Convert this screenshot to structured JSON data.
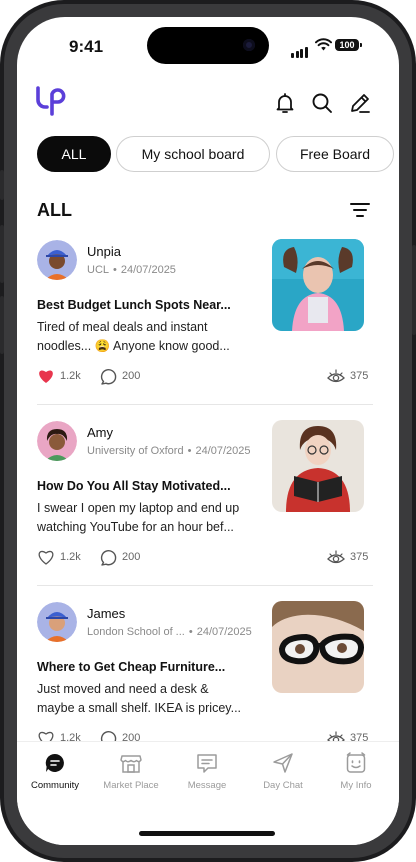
{
  "status_bar": {
    "time": "9:41",
    "battery": "100"
  },
  "header": {
    "logo": "logo-icon",
    "icons": [
      "bell-icon",
      "search-icon",
      "pencil-icon"
    ]
  },
  "tabs": [
    {
      "label": "ALL",
      "active": true
    },
    {
      "label": "My school board",
      "active": false
    },
    {
      "label": "Free Board",
      "active": false
    }
  ],
  "section": {
    "title": "ALL"
  },
  "posts": [
    {
      "author": "Unpia",
      "school": "UCL",
      "date": "24/07/2025",
      "title": "Best Budget Lunch Spots Near...",
      "body": "Tired of meal deals and instant noodles... 😩 Anyone know good...",
      "likes": "1.2k",
      "liked": true,
      "comments": "200",
      "views": "375"
    },
    {
      "author": "Amy",
      "school": "University of Oxford",
      "date": "24/07/2025",
      "title": "How Do You All Stay Motivated...",
      "body": "I swear I open my laptop and end up watching YouTube for an hour bef...",
      "likes": "1.2k",
      "liked": false,
      "comments": "200",
      "views": "375"
    },
    {
      "author": "James",
      "school": "London School of ...",
      "date": "24/07/2025",
      "title": "Where to Get Cheap Furniture...",
      "body": "Just moved and need a desk & maybe a small shelf. IKEA is pricey...",
      "likes": "1.2k",
      "liked": false,
      "comments": "200",
      "views": "375"
    }
  ],
  "bottom_nav": [
    {
      "label": "Community",
      "icon": "chat-bubble-icon",
      "active": true
    },
    {
      "label": "Market Place",
      "icon": "store-icon",
      "active": false
    },
    {
      "label": "Message",
      "icon": "message-icon",
      "active": false
    },
    {
      "label": "Day Chat",
      "icon": "send-icon",
      "active": false
    },
    {
      "label": "My Info",
      "icon": "smiley-icon",
      "active": false
    }
  ],
  "colors": {
    "accent": "#5b3fd9",
    "like": "#e8354d",
    "tab_active_bg": "#0b0b0b"
  }
}
